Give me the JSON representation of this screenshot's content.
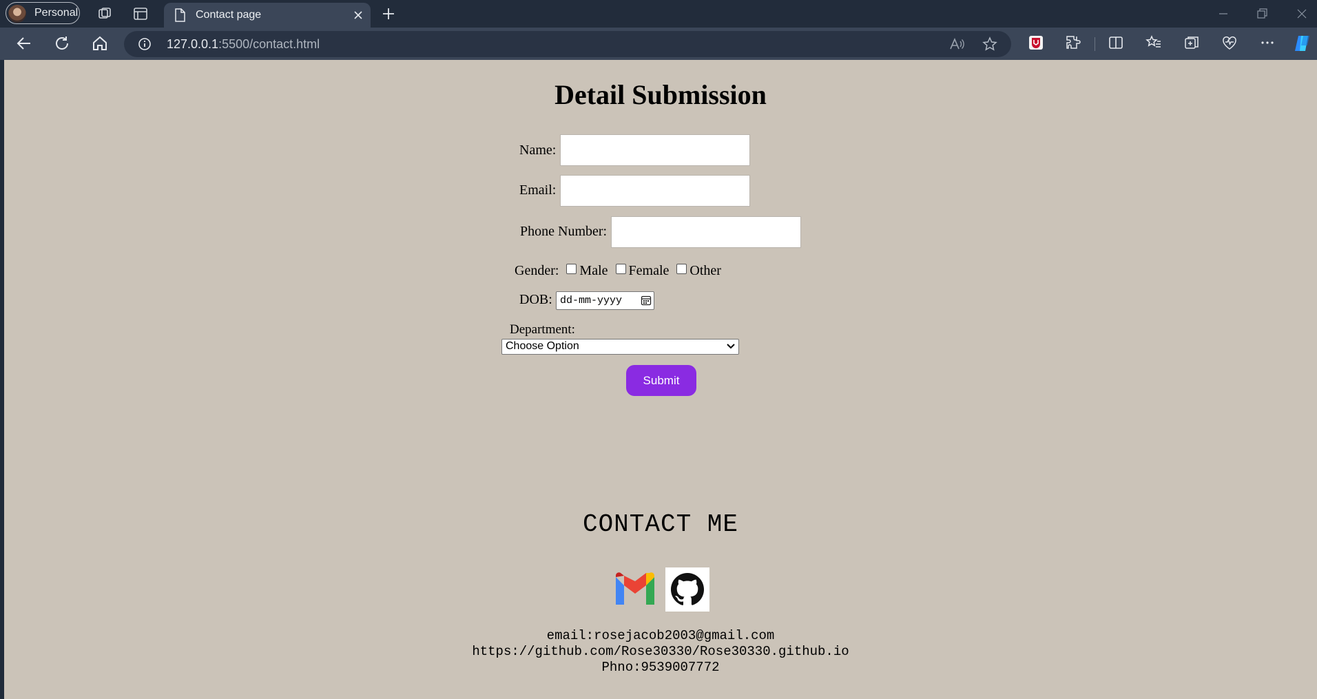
{
  "browser": {
    "profile_label": "Personal",
    "tab_title": "Contact page",
    "url_host": "127.0.0.1",
    "url_rest": ":5500/contact.html"
  },
  "page": {
    "heading": "Detail Submission",
    "form": {
      "name_label": "Name:",
      "email_label": "Email:",
      "phone_label": "Phone Number:",
      "gender_label": "Gender:",
      "gender_options": [
        "Male",
        "Female",
        "Other"
      ],
      "dob_label": "DOB:",
      "dob_placeholder": "dd-mm-yyyy",
      "department_label": "Department:",
      "department_selected": "Choose Option",
      "submit_label": "Submit"
    },
    "contact": {
      "title": "CONTACT ME",
      "email_line": "email:rosejacob2003@gmail.com",
      "github_line": "https://github.com/Rose30330/Rose30330.github.io",
      "phone_line": "Phno:9539007772"
    }
  },
  "colors": {
    "page_bg": "#cbc3b8",
    "submit_bg": "#8a2be2",
    "browser_bg": "#222c3b"
  },
  "icons": [
    "gmail-icon",
    "github-icon"
  ]
}
